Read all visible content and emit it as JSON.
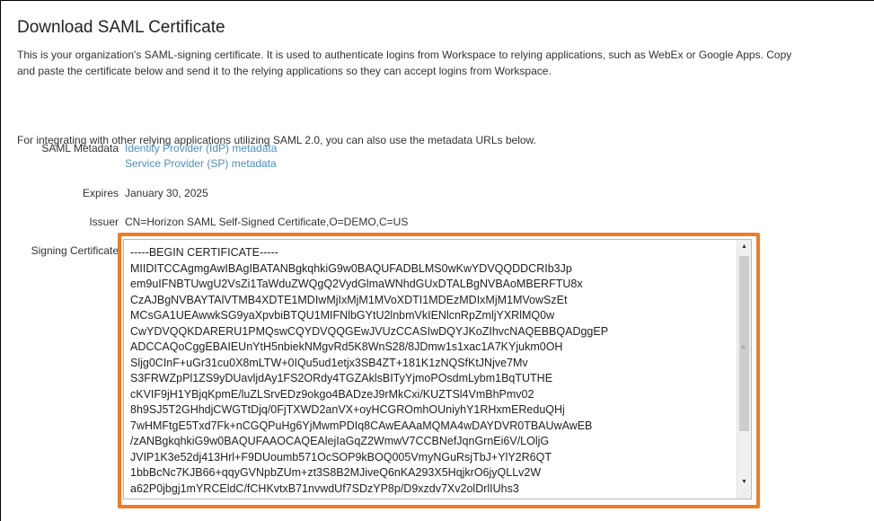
{
  "page": {
    "title": "Download SAML Certificate",
    "intro_line1": "This is your organization's SAML-signing certificate. It is used to authenticate logins from Workspace to relying applications, such as WebEx or Google Apps. Copy",
    "intro_line2": "and paste the certificate below and send it to the relying applications so they can accept logins from Workspace.",
    "integrating_text": "For integrating with other relying applications utilizing SAML 2.0, you can also use the metadata URLs below."
  },
  "saml_metadata": {
    "label": "SAML Metadata",
    "idp_link": "Identity Provider (IdP) metadata",
    "sp_link": "Service Provider (SP) metadata"
  },
  "expires": {
    "label": "Expires",
    "value": "January 30, 2025"
  },
  "issuer": {
    "label": "Issuer",
    "value": "CN=Horizon SAML Self-Signed Certificate,O=DEMO,C=US"
  },
  "signing_certificate": {
    "label": "Signing Certificate",
    "text": "-----BEGIN CERTIFICATE-----\nMIIDITCCAgmgAwIBAgIBATANBgkqhkiG9w0BAQUFADBLMS0wKwYDVQQDDCRIb3Jp\nem9uIFNBTUwgU2VsZi1TaWduZWQgQ2VydGlmaWNhdGUxDTALBgNVBAoMBERFTU8x\nCzAJBgNVBAYTAlVTMB4XDTE1MDIwMjIxMjM1MVoXDTI1MDEzMDIxMjM1MVowSzEt\nMCsGA1UEAwwkSG9yaXpvbiBTQU1MIFNlbGYtU2lnbmVkIENlcnRpZmljYXRlMQ0w\nCwYDVQQKDARERU1PMQswCQYDVQQGEwJVUzCCASIwDQYJKoZIhvcNAQEBBQADggEP\nADCCAQoCggEBAIEUnYtH5nbiekNMgvRd5K8WnS28/8JDmw1s1xac1A7KYjukm0OH\nSljg0CInF+uGr31cu0X8mLTW+0IQu5ud1etjx3SB4ZT+181K1zNQSfKtJNjve7Mv\nS3FRWZpPl1ZS9yDUavljdAy1FS2ORdy4TGZAklsBITyYjmoPOsdmLybm1BqTUTHE\ncKVIF9jH1YBjqKpmE/luZLSrvEDz9okgo4BADzeJ9rMkCxi/KUZTSl4VmBhPmv02\n8h9SJ5T2GHhdjCWGTtDjq/0FjTXWD2anVX+oyHCGROmhOUniyhY1RHxmEReduQHj\n7wHMFtgE5Txd7Fk+nCGQPuHg6YjMwmPDIq8CAwEAAaMQMA4wDAYDVR0TBAUwAwEB\n/zANBgkqhkiG9w0BAQUFAAOCAQEAlejIaGqZ2WmwV7CCBNefJqnGrnEi6V/LOljG\nJVIP1K3e52dj413Hrl+F9DUoumb571OcSOP9kBOQ005VmyNGuRsjTbJ+YlY2R6QT\n1bbBcNc7KJB66+qqyGVNpbZUm+zt3S8B2MJiveQ6nKA293X5HqjkrO6jyQLLv2W\na62P0jbgj1mYRCEldC/fCHKvtxB71nvwdUf7SDzYP8p/D9xzdv7Xv2olDrlIUhs3"
  }
}
